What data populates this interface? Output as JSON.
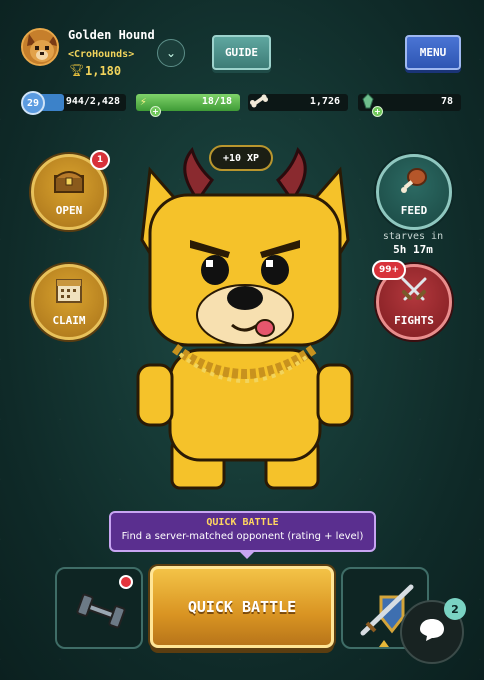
{
  "player": {
    "name": "Golden Hound",
    "guild": "<CroHounds>",
    "rating": "1,180"
  },
  "header": {
    "guide_label": "GUIDE",
    "menu_label": "MENU"
  },
  "stats": {
    "level": "29",
    "xp": "944/2,428",
    "xp_progress": 0.39,
    "energy": "18/18",
    "energy_progress": 1.0,
    "bones": "1,726",
    "gems": "78"
  },
  "xp_reward": "+10 XP",
  "actions": {
    "open_label": "OPEN",
    "open_badge": "1",
    "claim_label": "CLAIM",
    "feed_label": "FEED",
    "starves_label": "starves in",
    "starves_time": "5h 17m",
    "fights_label": "FIGHTS",
    "fights_badge": "99+"
  },
  "tooltip": {
    "title": "QUICK BATTLE",
    "description": "Find a server-matched opponent (rating + level)"
  },
  "bottom": {
    "quick_battle_label": "QUICK BATTLE"
  },
  "chat": {
    "badge": "2"
  },
  "colors": {
    "gold": "#d99422",
    "teal": "#2c6a63",
    "red": "#b3383d",
    "purple": "#5a2f8f",
    "blue_menu": "#2e56b3"
  }
}
